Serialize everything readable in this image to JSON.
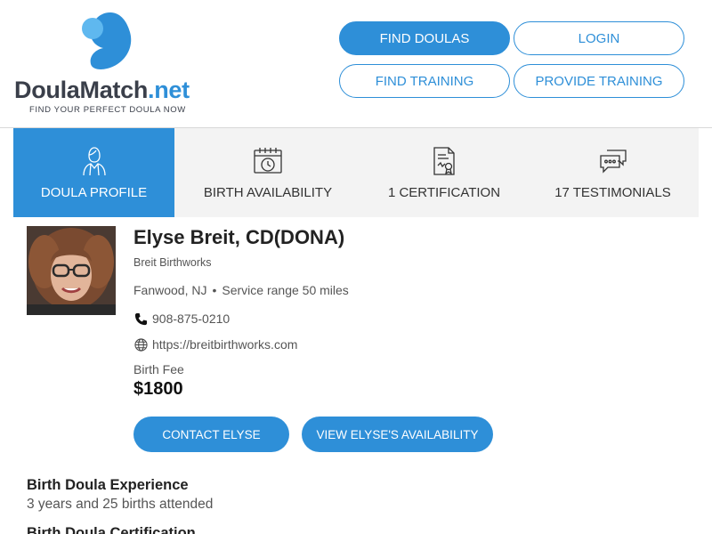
{
  "brand": {
    "name_main": "DoulaMatch",
    "name_suffix": ".net",
    "tagline": "FIND YOUR PERFECT DOULA NOW",
    "accent": "#2e8fd8",
    "accent_light": "#5fb8ef",
    "dark": "#3a3f4a"
  },
  "nav": {
    "find_doulas": "FIND DOULAS",
    "login": "LOGIN",
    "find_training": "FIND TRAINING",
    "provide_training": "PROVIDE TRAINING"
  },
  "tabs": [
    {
      "label": "DOULA PROFILE",
      "icon": "doula-person-icon",
      "active": true
    },
    {
      "label": "BIRTH AVAILABILITY",
      "icon": "calendar-clock-icon",
      "active": false
    },
    {
      "label": "1 CERTIFICATION",
      "icon": "certificate-document-icon",
      "active": false
    },
    {
      "label": "17 TESTIMONIALS",
      "icon": "chat-bubbles-icon",
      "active": false
    }
  ],
  "profile": {
    "name": "Elyse Breit, CD(DONA)",
    "business": "Breit Birthworks",
    "location": "Fanwood, NJ",
    "service_range": "Service range 50 miles",
    "phone": "908-875-0210",
    "website": "https://breitbirthworks.com",
    "fee_label": "Birth Fee",
    "fee_value": "$1800"
  },
  "actions": {
    "contact": "CONTACT ELYSE",
    "availability": "VIEW ELYSE'S AVAILABILITY"
  },
  "sections": {
    "experience_title": "Birth Doula Experience",
    "experience_body": "3 years and 25 births attended",
    "certification_title": "Birth Doula Certification"
  }
}
